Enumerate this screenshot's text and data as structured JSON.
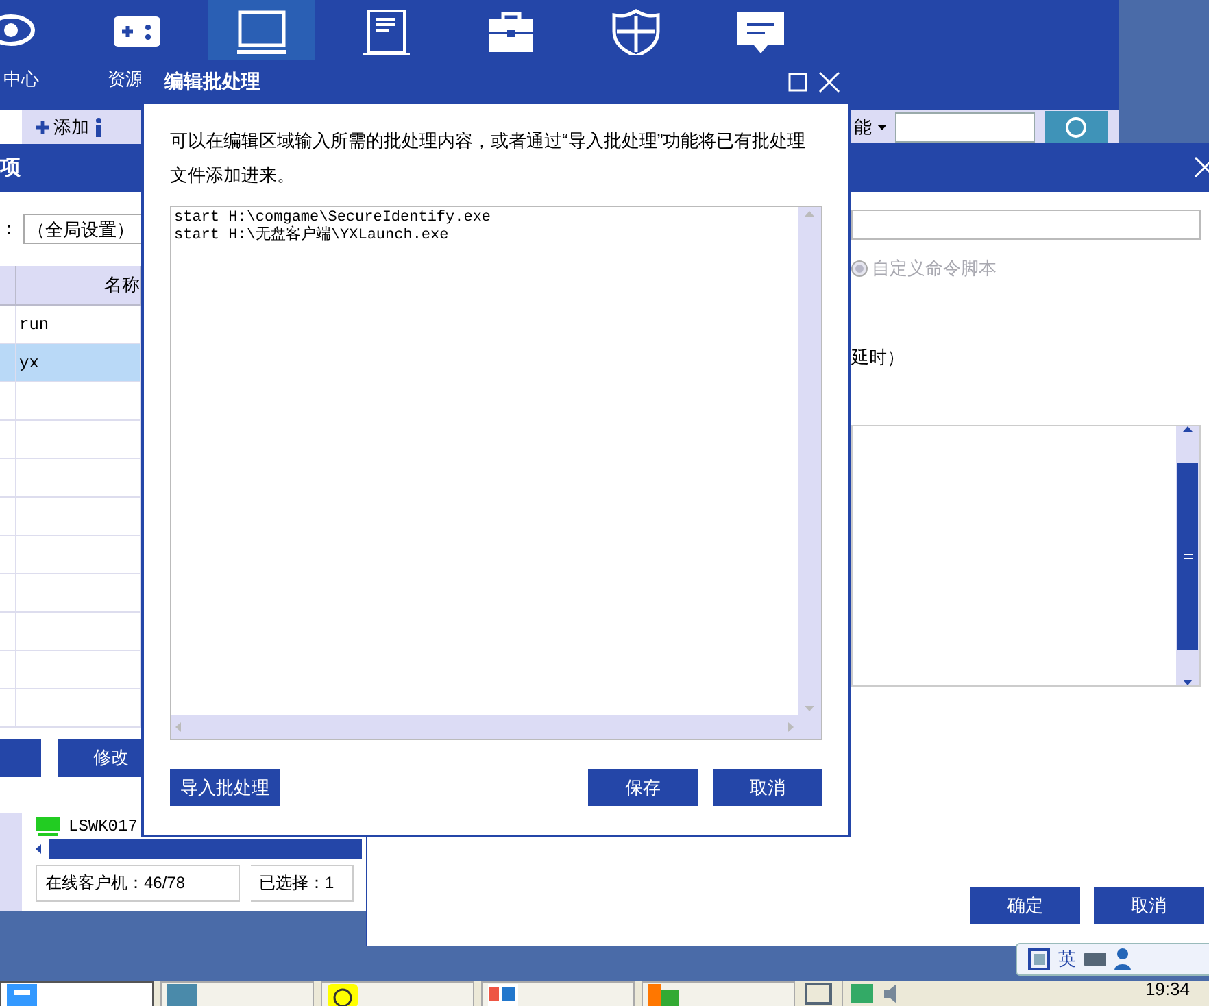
{
  "nav": {
    "items": [
      {
        "label": "中心",
        "selected": false
      },
      {
        "label": "资源",
        "selected": false
      },
      {
        "selected": true
      },
      {
        "selected": false
      },
      {
        "selected": false
      },
      {
        "selected": false
      },
      {
        "selected": false
      }
    ]
  },
  "toolbar": {
    "add_label": "添加",
    "menu_label": "能"
  },
  "client_panel": {
    "title": "项",
    "scope_label": "：",
    "scope_value": "（全局设置）",
    "column": "名称",
    "rows": [
      {
        "name": "run",
        "selected": false
      },
      {
        "name": "yx",
        "selected": true
      }
    ],
    "edit_button": "修改",
    "client": "LSWK017",
    "status": [
      "在线客户机：46/78",
      "已选择：1"
    ]
  },
  "script_window": {
    "radio": {
      "label": "自定义命令脚本",
      "selected": true,
      "disabled": true
    },
    "note": "延时）",
    "buttons": [
      "确定",
      "取消"
    ]
  },
  "dialog": {
    "title": "编辑批处理",
    "description": "可以在编辑区域输入所需的批处理内容，或者通过“导入批处理”功能将已有批处理文件添加进来。",
    "lines": [
      "start H:\\comgame\\SecureIdentify.exe",
      "start H:\\无盘客户端\\YXLaunch.exe"
    ],
    "import_button": "导入批处理",
    "buttons": [
      "保存",
      "取消"
    ]
  },
  "tray": {
    "ime": "英"
  },
  "clock": "19:34"
}
